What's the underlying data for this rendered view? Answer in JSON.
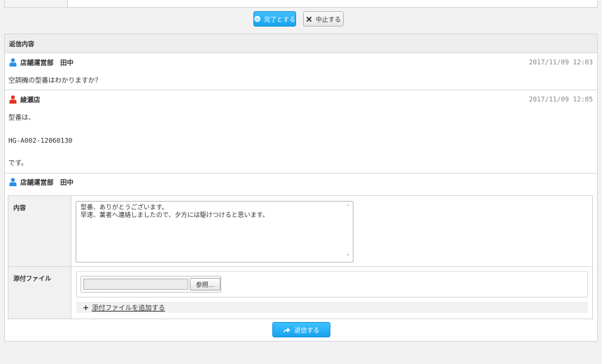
{
  "actions": {
    "complete_label": "完了とする",
    "abort_label": "中止する"
  },
  "reply_section": {
    "header": "返信内容",
    "messages": [
      {
        "author": "店舗運営部　田中",
        "timestamp": "2017/11/09 12:03",
        "lines": [
          "空調機の型番はわかりますか？"
        ],
        "icon_color": "#2e8fe8"
      },
      {
        "author": "綾瀬店",
        "timestamp": "2017/11/09 12:05",
        "lines": [
          "型番は、",
          "HG-A002-12060130",
          "です。"
        ],
        "icon_color": "#e0331e"
      }
    ]
  },
  "reply_form": {
    "author": "店舗運営部　田中",
    "author_icon_color": "#2e8fe8",
    "content_label": "内容",
    "content_value": "型番、ありがとうございます。\n早速、業者へ連絡しましたので、夕方には駆けつけると思います。",
    "attachment_label": "添付ファイル",
    "file_name_value": "",
    "browse_label": "参照...",
    "add_file_label": "添付ファイルを追加する",
    "submit_label": "返信する"
  },
  "colors": {
    "accent": "#1ba7f0",
    "panel_border": "#d6d6d6"
  }
}
